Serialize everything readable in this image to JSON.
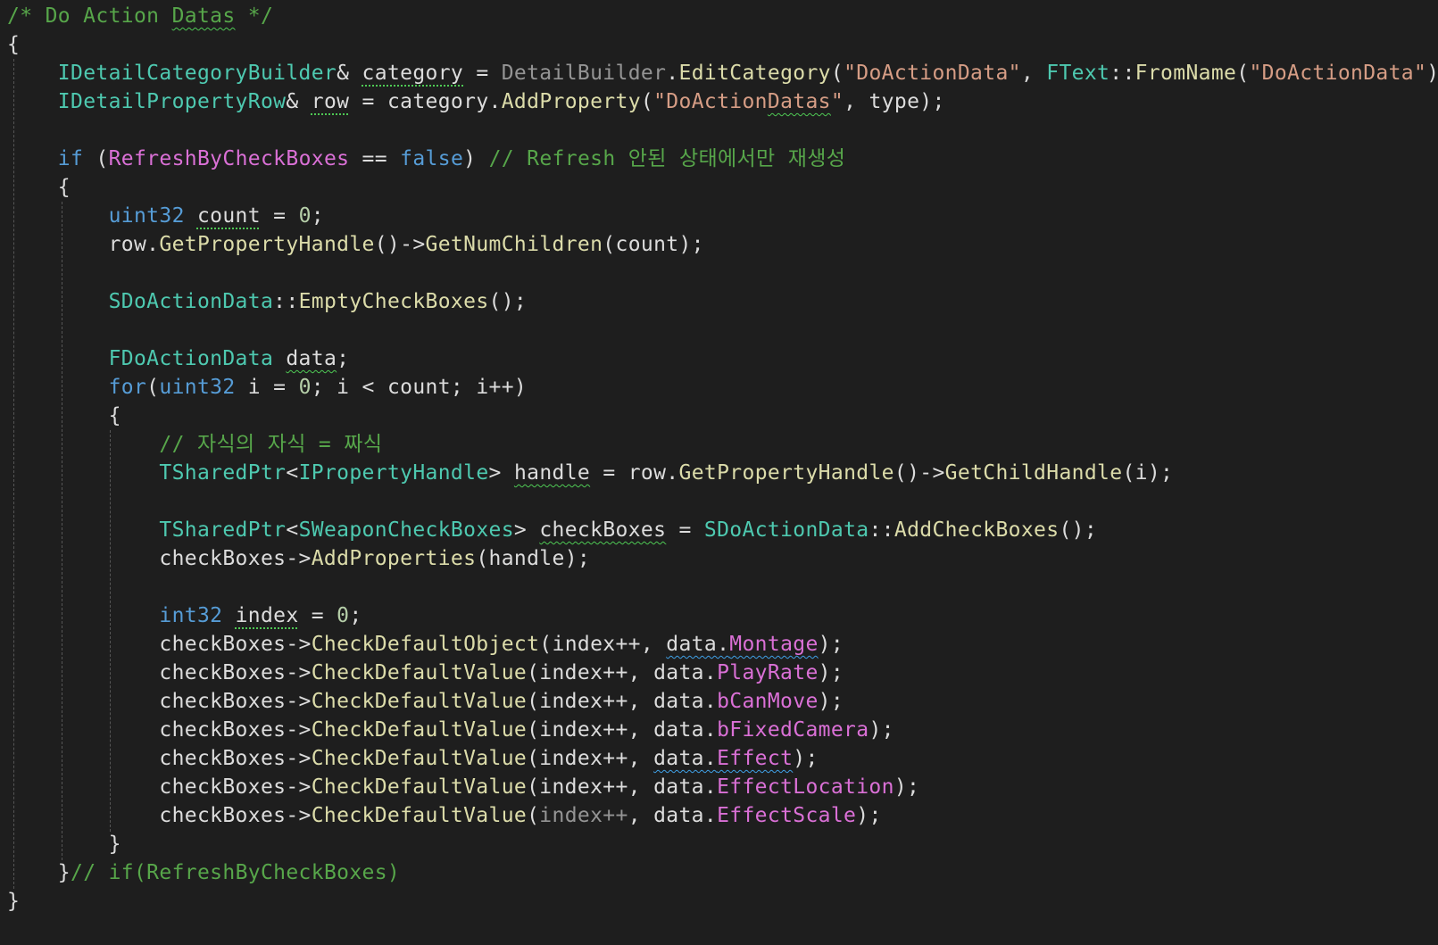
{
  "theme": {
    "background": "#1e1e1e",
    "default": "#dcdcdc",
    "comment": "#57a64a",
    "keyword": "#569cd6",
    "type": "#4ec9b0",
    "function": "#dcdcaa",
    "string": "#d69d85",
    "field": "#da70d6",
    "guide": "#555555",
    "squiggle_green": "#4ec954",
    "squiggle_blue": "#3fa0e6"
  },
  "code_lines": [
    [
      {
        "t": "/* Do Action ",
        "c": "comment"
      },
      {
        "t": "Datas",
        "c": "comment",
        "u": "sg"
      },
      {
        "t": " */",
        "c": "comment"
      }
    ],
    [
      {
        "t": "{",
        "c": "default"
      }
    ],
    [
      {
        "t": "    ",
        "c": "default"
      },
      {
        "t": "IDetailCategoryBuilder",
        "c": "type"
      },
      {
        "t": "& ",
        "c": "default"
      },
      {
        "t": "category",
        "c": "default",
        "u": "dg"
      },
      {
        "t": " = ",
        "c": "default"
      },
      {
        "t": "DetailBuilder",
        "c": "default",
        "dim": true
      },
      {
        "t": ".",
        "c": "default"
      },
      {
        "t": "EditCategory",
        "c": "function"
      },
      {
        "t": "(",
        "c": "default"
      },
      {
        "t": "\"DoActionData\"",
        "c": "string"
      },
      {
        "t": ", ",
        "c": "default"
      },
      {
        "t": "FText",
        "c": "type"
      },
      {
        "t": "::",
        "c": "default"
      },
      {
        "t": "FromName",
        "c": "function"
      },
      {
        "t": "(",
        "c": "default"
      },
      {
        "t": "\"DoActionData\"",
        "c": "string"
      },
      {
        "t": "));",
        "c": "default"
      }
    ],
    [
      {
        "t": "    ",
        "c": "default"
      },
      {
        "t": "IDetailPropertyRow",
        "c": "type"
      },
      {
        "t": "& ",
        "c": "default"
      },
      {
        "t": "row",
        "c": "default",
        "u": "dg"
      },
      {
        "t": " = category.",
        "c": "default"
      },
      {
        "t": "AddProperty",
        "c": "function"
      },
      {
        "t": "(",
        "c": "default"
      },
      {
        "t": "\"DoAction",
        "c": "string"
      },
      {
        "t": "Datas",
        "c": "string",
        "u": "sg"
      },
      {
        "t": "\"",
        "c": "string"
      },
      {
        "t": ", type);",
        "c": "default"
      }
    ],
    [],
    [
      {
        "t": "    ",
        "c": "default"
      },
      {
        "t": "if",
        "c": "keyword"
      },
      {
        "t": " (",
        "c": "default"
      },
      {
        "t": "RefreshByCheckBoxes",
        "c": "field"
      },
      {
        "t": " == ",
        "c": "default"
      },
      {
        "t": "false",
        "c": "keyword"
      },
      {
        "t": ") ",
        "c": "default"
      },
      {
        "t": "// Refresh 안된 상태에서만 재생성",
        "c": "comment"
      }
    ],
    [
      {
        "t": "    {",
        "c": "default"
      }
    ],
    [
      {
        "t": "        ",
        "c": "default"
      },
      {
        "t": "uint32",
        "c": "keyword"
      },
      {
        "t": " ",
        "c": "default"
      },
      {
        "t": "count",
        "c": "default",
        "u": "dg"
      },
      {
        "t": " = ",
        "c": "default"
      },
      {
        "t": "0",
        "c": "number"
      },
      {
        "t": ";",
        "c": "default"
      }
    ],
    [
      {
        "t": "        row.",
        "c": "default"
      },
      {
        "t": "GetPropertyHandle",
        "c": "function"
      },
      {
        "t": "()->",
        "c": "default"
      },
      {
        "t": "GetNumChildren",
        "c": "function"
      },
      {
        "t": "(count);",
        "c": "default"
      }
    ],
    [],
    [
      {
        "t": "        ",
        "c": "default"
      },
      {
        "t": "SDoActionData",
        "c": "type"
      },
      {
        "t": "::",
        "c": "default"
      },
      {
        "t": "EmptyCheckBoxes",
        "c": "function"
      },
      {
        "t": "();",
        "c": "default"
      }
    ],
    [],
    [
      {
        "t": "        ",
        "c": "default"
      },
      {
        "t": "FDoActionData",
        "c": "type"
      },
      {
        "t": " ",
        "c": "default"
      },
      {
        "t": "data",
        "c": "default",
        "u": "sg"
      },
      {
        "t": ";",
        "c": "default"
      }
    ],
    [
      {
        "t": "        ",
        "c": "default"
      },
      {
        "t": "for",
        "c": "keyword"
      },
      {
        "t": "(",
        "c": "default"
      },
      {
        "t": "uint32",
        "c": "keyword"
      },
      {
        "t": " i = ",
        "c": "default"
      },
      {
        "t": "0",
        "c": "number"
      },
      {
        "t": "; i < count; i++)",
        "c": "default"
      }
    ],
    [
      {
        "t": "        {",
        "c": "default"
      }
    ],
    [
      {
        "t": "            ",
        "c": "default"
      },
      {
        "t": "// 자식의 자식 = 짜식",
        "c": "comment"
      }
    ],
    [
      {
        "t": "            ",
        "c": "default"
      },
      {
        "t": "TSharedPtr",
        "c": "type"
      },
      {
        "t": "<",
        "c": "default"
      },
      {
        "t": "IPropertyHandle",
        "c": "type"
      },
      {
        "t": "> ",
        "c": "default"
      },
      {
        "t": "handle",
        "c": "default",
        "u": "sg"
      },
      {
        "t": " = row.",
        "c": "default"
      },
      {
        "t": "GetPropertyHandle",
        "c": "function"
      },
      {
        "t": "()->",
        "c": "default"
      },
      {
        "t": "GetChildHandle",
        "c": "function"
      },
      {
        "t": "(i);",
        "c": "default"
      }
    ],
    [],
    [
      {
        "t": "            ",
        "c": "default"
      },
      {
        "t": "TSharedPtr",
        "c": "type"
      },
      {
        "t": "<",
        "c": "default"
      },
      {
        "t": "SWeaponCheckBoxes",
        "c": "type"
      },
      {
        "t": "> ",
        "c": "default"
      },
      {
        "t": "checkBoxes",
        "c": "default",
        "u": "sg"
      },
      {
        "t": " = ",
        "c": "default"
      },
      {
        "t": "SDoActionData",
        "c": "type"
      },
      {
        "t": "::",
        "c": "default"
      },
      {
        "t": "AddCheckBoxes",
        "c": "function"
      },
      {
        "t": "();",
        "c": "default"
      }
    ],
    [
      {
        "t": "            checkBoxes->",
        "c": "default"
      },
      {
        "t": "AddProperties",
        "c": "function"
      },
      {
        "t": "(handle);",
        "c": "default"
      }
    ],
    [],
    [
      {
        "t": "            ",
        "c": "default"
      },
      {
        "t": "int32",
        "c": "keyword"
      },
      {
        "t": " ",
        "c": "default"
      },
      {
        "t": "index",
        "c": "default",
        "u": "dg"
      },
      {
        "t": " = ",
        "c": "default"
      },
      {
        "t": "0",
        "c": "number"
      },
      {
        "t": ";",
        "c": "default"
      }
    ],
    [
      {
        "t": "            checkBoxes->",
        "c": "default"
      },
      {
        "t": "CheckDefaultObject",
        "c": "function"
      },
      {
        "t": "(index++, ",
        "c": "default"
      },
      {
        "t": "data.",
        "c": "default",
        "u": "sb"
      },
      {
        "t": "Montage",
        "c": "field",
        "u": "sb"
      },
      {
        "t": ");",
        "c": "default"
      }
    ],
    [
      {
        "t": "            checkBoxes->",
        "c": "default"
      },
      {
        "t": "CheckDefaultValue",
        "c": "function"
      },
      {
        "t": "(index++, data.",
        "c": "default"
      },
      {
        "t": "PlayRate",
        "c": "field"
      },
      {
        "t": ");",
        "c": "default"
      }
    ],
    [
      {
        "t": "            checkBoxes->",
        "c": "default"
      },
      {
        "t": "CheckDefaultValue",
        "c": "function"
      },
      {
        "t": "(index++, data.",
        "c": "default"
      },
      {
        "t": "bCanMove",
        "c": "field"
      },
      {
        "t": ");",
        "c": "default"
      }
    ],
    [
      {
        "t": "            checkBoxes->",
        "c": "default"
      },
      {
        "t": "CheckDefaultValue",
        "c": "function"
      },
      {
        "t": "(index++, data.",
        "c": "default"
      },
      {
        "t": "bFixedCamera",
        "c": "field"
      },
      {
        "t": ");",
        "c": "default"
      }
    ],
    [
      {
        "t": "            checkBoxes->",
        "c": "default"
      },
      {
        "t": "CheckDefaultValue",
        "c": "function"
      },
      {
        "t": "(index++, ",
        "c": "default"
      },
      {
        "t": "data.",
        "c": "default",
        "u": "sb"
      },
      {
        "t": "Effect",
        "c": "field",
        "u": "sb"
      },
      {
        "t": ");",
        "c": "default"
      }
    ],
    [
      {
        "t": "            checkBoxes->",
        "c": "default"
      },
      {
        "t": "CheckDefaultValue",
        "c": "function"
      },
      {
        "t": "(index++, data.",
        "c": "default"
      },
      {
        "t": "EffectLocation",
        "c": "field"
      },
      {
        "t": ");",
        "c": "default"
      }
    ],
    [
      {
        "t": "            checkBoxes->",
        "c": "default"
      },
      {
        "t": "CheckDefaultValue",
        "c": "function"
      },
      {
        "t": "(",
        "c": "default"
      },
      {
        "t": "index++",
        "c": "default",
        "dim": true
      },
      {
        "t": ", data.",
        "c": "default"
      },
      {
        "t": "EffectScale",
        "c": "field"
      },
      {
        "t": ");",
        "c": "default"
      }
    ],
    [
      {
        "t": "        }",
        "c": "default"
      }
    ],
    [
      {
        "t": "    }",
        "c": "default"
      },
      {
        "t": "// if(RefreshByCheckBoxes)",
        "c": "comment"
      }
    ],
    [
      {
        "t": "}",
        "c": "default"
      }
    ]
  ]
}
